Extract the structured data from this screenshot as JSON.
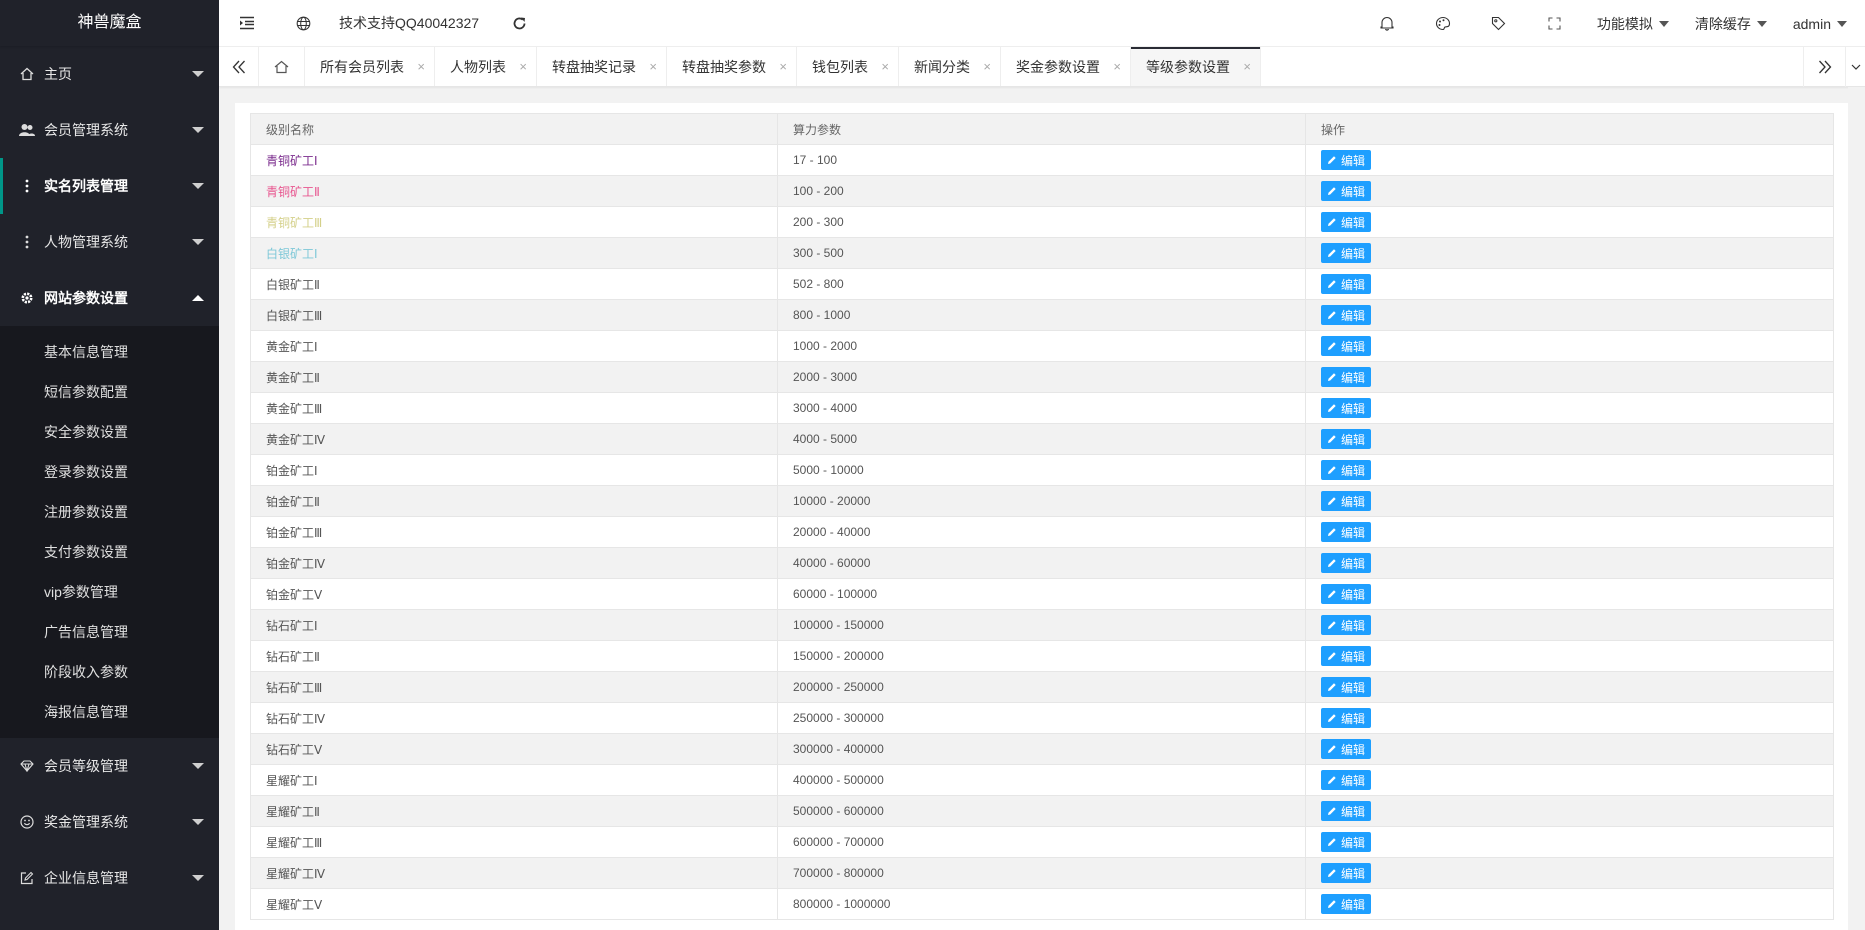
{
  "app": {
    "title": "神兽魔盒"
  },
  "sidebar": {
    "items_top": [
      {
        "label": "主页",
        "icon": "home-icon"
      },
      {
        "label": "会员管理系统",
        "icon": "users-icon"
      },
      {
        "label": "实名列表管理",
        "icon": "dots-icon"
      },
      {
        "label": "人物管理系统",
        "icon": "dots-icon"
      },
      {
        "label": "网站参数设置",
        "icon": "gear-icon"
      }
    ],
    "submenu": [
      "基本信息管理",
      "短信参数配置",
      "安全参数设置",
      "登录参数设置",
      "注册参数设置",
      "支付参数设置",
      "vip参数管理",
      "广告信息管理",
      "阶段收入参数",
      "海报信息管理"
    ],
    "items_bottom": [
      {
        "label": "会员等级管理",
        "icon": "diamond-icon"
      },
      {
        "label": "奖金管理系统",
        "icon": "smile-icon"
      },
      {
        "label": "企业信息管理",
        "icon": "edit-box-icon"
      }
    ]
  },
  "header": {
    "support_text": "技术支持QQ40042327",
    "menus": [
      "功能模拟",
      "清除缓存",
      "admin"
    ]
  },
  "tabs": [
    "所有会员列表",
    "人物列表",
    "转盘抽奖记录",
    "转盘抽奖参数",
    "钱包列表",
    "新闻分类",
    "奖金参数设置",
    "等级参数设置"
  ],
  "tab_close_glyph": "×",
  "table": {
    "headers": [
      "级别名称",
      "算力参数",
      "操作"
    ],
    "edit_label": "编辑",
    "rows": [
      {
        "name": "青铜矿工Ⅰ",
        "range": "17 - 100",
        "color": "#7a2a8c"
      },
      {
        "name": "青铜矿工Ⅱ",
        "range": "100 - 200",
        "color": "#e8558f"
      },
      {
        "name": "青铜矿工Ⅲ",
        "range": "200 - 300",
        "color": "#d4d08a"
      },
      {
        "name": "白银矿工Ⅰ",
        "range": "300 - 500",
        "color": "#7ec8d8"
      },
      {
        "name": "白银矿工Ⅱ",
        "range": "502 - 800",
        "color": ""
      },
      {
        "name": "白银矿工Ⅲ",
        "range": "800 - 1000",
        "color": ""
      },
      {
        "name": "黄金矿工Ⅰ",
        "range": "1000 - 2000",
        "color": ""
      },
      {
        "name": "黄金矿工Ⅱ",
        "range": "2000 - 3000",
        "color": ""
      },
      {
        "name": "黄金矿工Ⅲ",
        "range": "3000 - 4000",
        "color": ""
      },
      {
        "name": "黄金矿工Ⅳ",
        "range": "4000 - 5000",
        "color": ""
      },
      {
        "name": "铂金矿工Ⅰ",
        "range": "5000 - 10000",
        "color": ""
      },
      {
        "name": "铂金矿工Ⅱ",
        "range": "10000 - 20000",
        "color": ""
      },
      {
        "name": "铂金矿工Ⅲ",
        "range": "20000 - 40000",
        "color": ""
      },
      {
        "name": "铂金矿工Ⅳ",
        "range": "40000 - 60000",
        "color": ""
      },
      {
        "name": "铂金矿工Ⅴ",
        "range": "60000 - 100000",
        "color": ""
      },
      {
        "name": "钻石矿工Ⅰ",
        "range": "100000 - 150000",
        "color": ""
      },
      {
        "name": "钻石矿工Ⅱ",
        "range": "150000 - 200000",
        "color": ""
      },
      {
        "name": "钻石矿工Ⅲ",
        "range": "200000 - 250000",
        "color": ""
      },
      {
        "name": "钻石矿工Ⅳ",
        "range": "250000 - 300000",
        "color": ""
      },
      {
        "name": "钻石矿工Ⅴ",
        "range": "300000 - 400000",
        "color": ""
      },
      {
        "name": "星耀矿工Ⅰ",
        "range": "400000 - 500000",
        "color": ""
      },
      {
        "name": "星耀矿工Ⅱ",
        "range": "500000 - 600000",
        "color": ""
      },
      {
        "name": "星耀矿工Ⅲ",
        "range": "600000 - 700000",
        "color": ""
      },
      {
        "name": "星耀矿工Ⅳ",
        "range": "700000 - 800000",
        "color": ""
      },
      {
        "name": "星耀矿工Ⅴ",
        "range": "800000 - 1000000",
        "color": ""
      }
    ]
  },
  "colors": {
    "sidebar_bg": "#20222a",
    "accent": "#009688",
    "button": "#1e9fff"
  }
}
